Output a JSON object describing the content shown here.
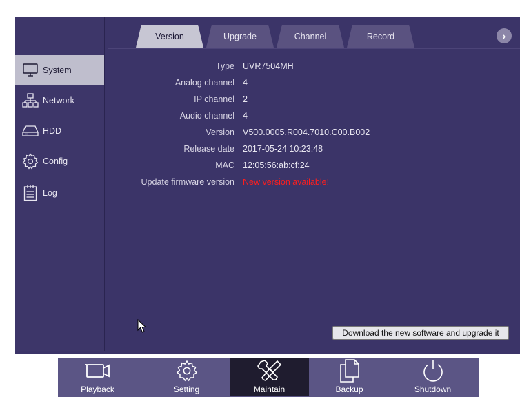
{
  "sidebar": {
    "items": [
      {
        "label": "System",
        "icon": "monitor-icon",
        "active": true
      },
      {
        "label": "Network",
        "icon": "network-icon",
        "active": false
      },
      {
        "label": "HDD",
        "icon": "hdd-icon",
        "active": false
      },
      {
        "label": "Config",
        "icon": "gear-icon",
        "active": false
      },
      {
        "label": "Log",
        "icon": "log-icon",
        "active": false
      }
    ]
  },
  "tabs": [
    {
      "label": "Version",
      "active": true
    },
    {
      "label": "Upgrade",
      "active": false
    },
    {
      "label": "Channel",
      "active": false
    },
    {
      "label": "Record",
      "active": false
    }
  ],
  "info": [
    {
      "label": "Type",
      "value": "UVR7504MH"
    },
    {
      "label": "Analog channel",
      "value": "4"
    },
    {
      "label": "IP channel",
      "value": "2"
    },
    {
      "label": "Audio channel",
      "value": "4"
    },
    {
      "label": "Version",
      "value": "V500.0005.R004.7010.C00.B002"
    },
    {
      "label": "Release date",
      "value": "2017-05-24 10:23:48"
    },
    {
      "label": "MAC",
      "value": "12:05:56:ab:cf:24"
    },
    {
      "label": "Update firmware version",
      "value": "New version available!"
    }
  ],
  "upgrade_button": "Download the new software and upgrade it",
  "dock": [
    {
      "label": "Playback",
      "icon": "camera-icon",
      "active": false
    },
    {
      "label": "Setting",
      "icon": "gear-icon",
      "active": false
    },
    {
      "label": "Maintain",
      "icon": "tools-icon",
      "active": true
    },
    {
      "label": "Backup",
      "icon": "copy-icon",
      "active": false
    },
    {
      "label": "Shutdown",
      "icon": "power-icon",
      "active": false
    }
  ],
  "colors": {
    "alert": "#ff1e1e",
    "panel": "#3b3468",
    "active_tab": "#c7c6d3"
  }
}
